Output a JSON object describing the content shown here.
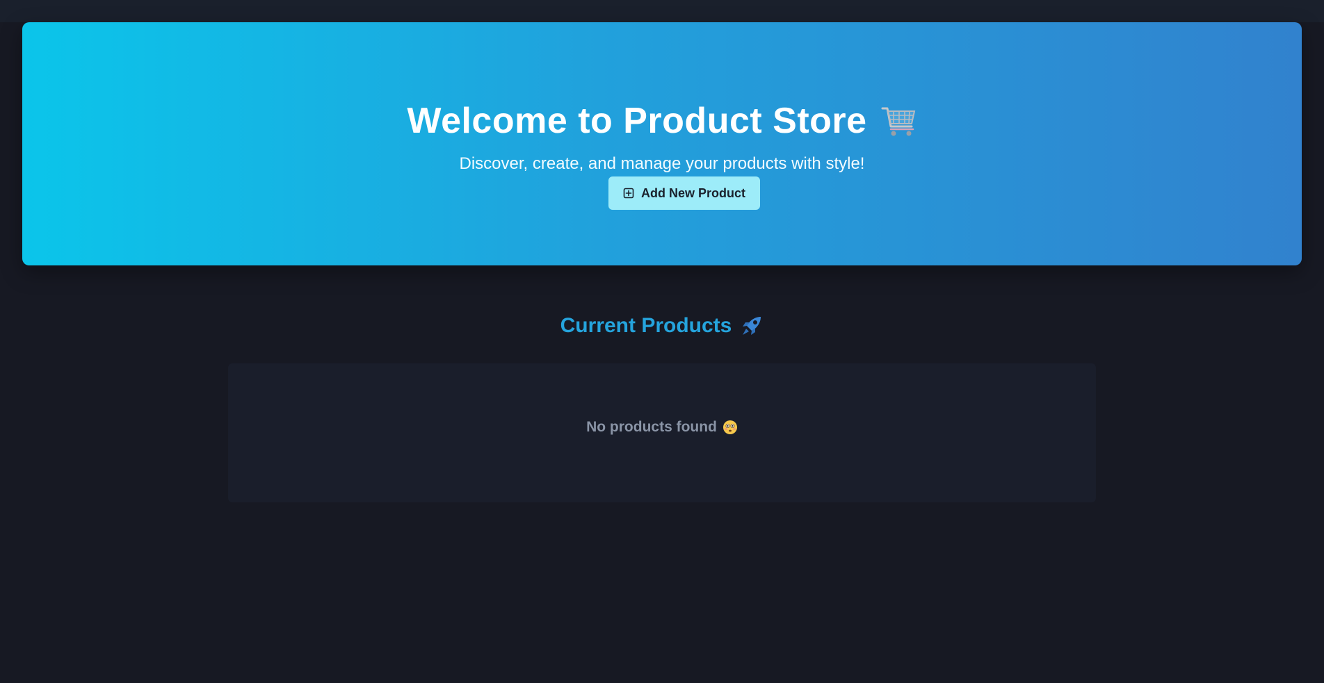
{
  "hero": {
    "title": "Welcome to Product Store",
    "title_icon": "shopping-cart-icon",
    "subtitle": "Discover, create, and manage your products with style!",
    "add_button_label": "Add New Product",
    "add_button_icon": "plus-square-icon"
  },
  "products": {
    "section_title": "Current Products",
    "section_icon": "rocket-icon",
    "empty_message": "No products found",
    "empty_icon": "flushed-face-icon",
    "items": []
  },
  "colors": {
    "background": "#171923",
    "hero_gradient_start": "#0bc5ea",
    "hero_gradient_end": "#3182ce",
    "button": "#9decf9",
    "section_title": "#25a4dd",
    "empty_text": "#8a94a6"
  }
}
